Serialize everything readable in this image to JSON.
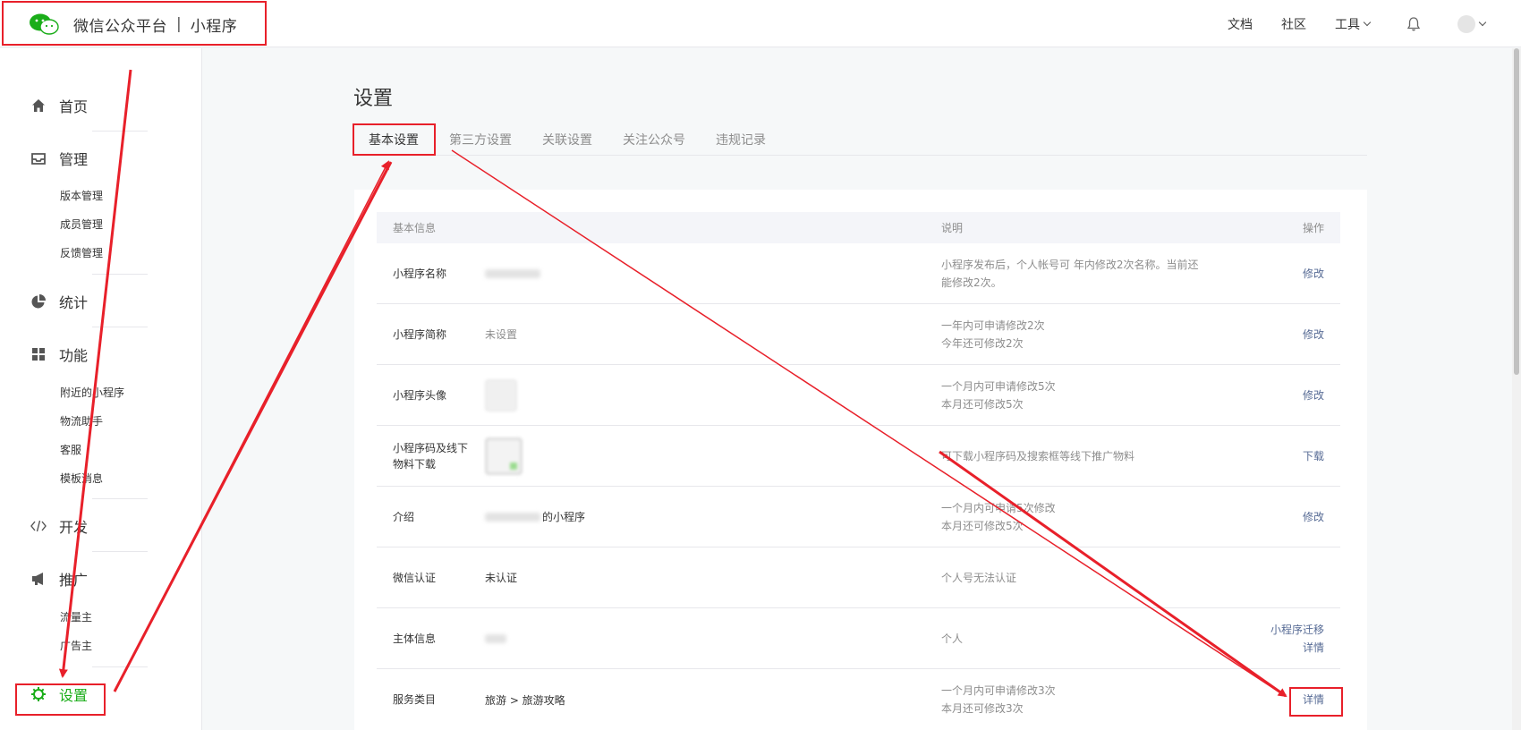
{
  "header": {
    "brand": "微信公众平台",
    "separator": "|",
    "product": "小程序",
    "nav": {
      "docs": "文档",
      "community": "社区",
      "tools": "工具"
    }
  },
  "sidebar": {
    "home": "首页",
    "manage": "管理",
    "manage_items": [
      "版本管理",
      "成员管理",
      "反馈管理"
    ],
    "stats": "统计",
    "features": "功能",
    "feature_items": [
      "附近的小程序",
      "物流助手",
      "客服",
      "模板消息"
    ],
    "dev": "开发",
    "promo": "推广",
    "promo_items": [
      "流量主",
      "广告主"
    ],
    "settings": "设置"
  },
  "page": {
    "title": "设置",
    "tabs": [
      "基本设置",
      "第三方设置",
      "关联设置",
      "关注公众号",
      "违规记录"
    ]
  },
  "table": {
    "headers": {
      "info": "基本信息",
      "desc": "说明",
      "op": "操作"
    },
    "rows": [
      {
        "label": "小程序名称",
        "value": "",
        "desc1": "小程序发布后，个人帐号可    年内修改2次名称。当前还",
        "desc2": "能修改2次。",
        "op1": "修改",
        "op2": ""
      },
      {
        "label": "小程序简称",
        "value": "未设置",
        "desc1": "一年内可申请修改2次",
        "desc2": "今年还可修改2次",
        "op1": "修改",
        "op2": ""
      },
      {
        "label": "小程序头像",
        "value": "",
        "desc1": "一个月内可申请修改5次",
        "desc2": "本月还可修改5次",
        "op1": "修改",
        "op2": ""
      },
      {
        "label": "小程序码及线下物料下载",
        "value": "",
        "desc1": "可下载小程序码及搜索框等线下推广物料",
        "desc2": "",
        "op1": "下载",
        "op2": ""
      },
      {
        "label": "介绍",
        "value": "的小程序",
        "desc1": "一个月内可申请5次修改",
        "desc2": "本月还可修改5次",
        "op1": "修改",
        "op2": ""
      },
      {
        "label": "微信认证",
        "value": "未认证",
        "desc1": "个人号无法认证",
        "desc2": "",
        "op1": "",
        "op2": ""
      },
      {
        "label": "主体信息",
        "value": "",
        "desc1": "个人",
        "desc2": "",
        "op1": "小程序迁移",
        "op2": "详情"
      },
      {
        "label": "服务类目",
        "value": "旅游 > 旅游攻略",
        "desc1": "一个月内可申请修改3次",
        "desc2": "本月还可修改3次",
        "op1": "详情",
        "op2": ""
      }
    ]
  },
  "colors": {
    "accent": "#1aad19",
    "link": "#576b95",
    "annotation": "#e8202a"
  }
}
